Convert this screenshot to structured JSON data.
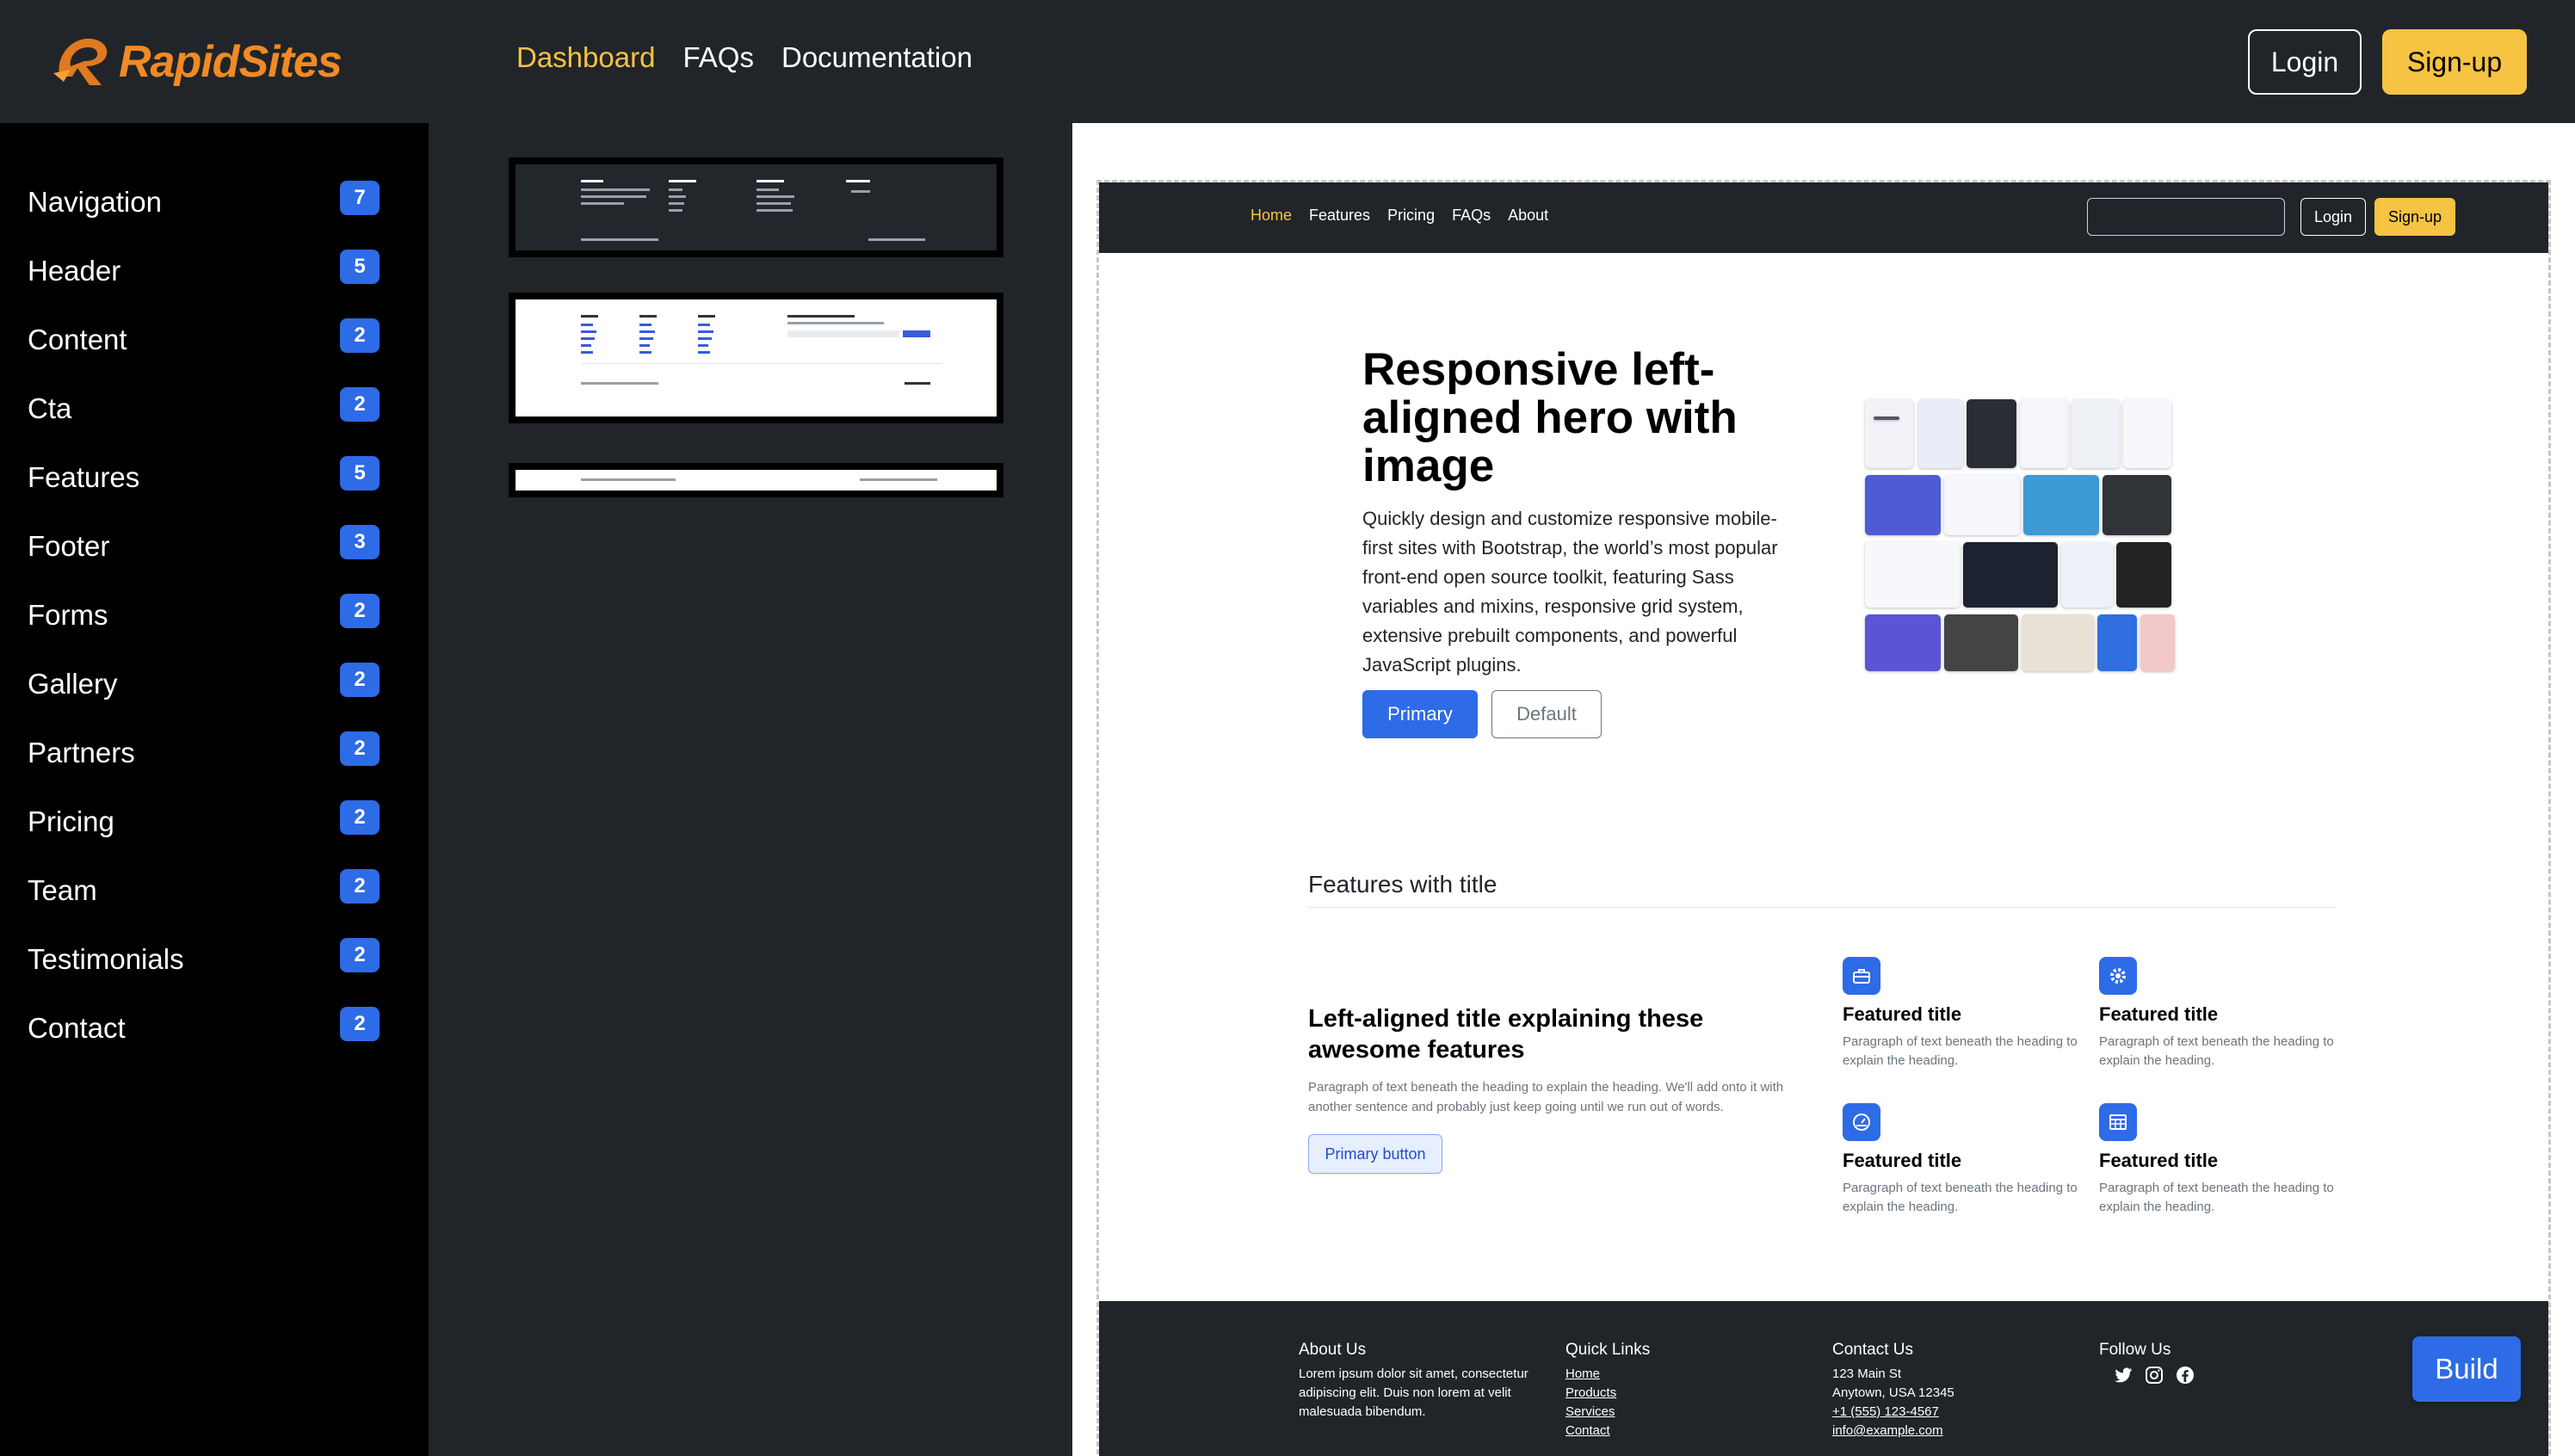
{
  "app": {
    "brand_part1": "Rapid",
    "brand_part2": "Sites",
    "accent_color": "#f6c343",
    "primary_color": "#2e6be6"
  },
  "top_nav": {
    "links": [
      {
        "label": "Dashboard",
        "active": true
      },
      {
        "label": "FAQs",
        "active": false
      },
      {
        "label": "Documentation",
        "active": false
      }
    ],
    "login_label": "Login",
    "signup_label": "Sign-up"
  },
  "sidebar": {
    "items": [
      {
        "label": "Navigation",
        "count": "7"
      },
      {
        "label": "Header",
        "count": "5"
      },
      {
        "label": "Content",
        "count": "2"
      },
      {
        "label": "Cta",
        "count": "2"
      },
      {
        "label": "Features",
        "count": "5"
      },
      {
        "label": "Footer",
        "count": "3"
      },
      {
        "label": "Forms",
        "count": "2"
      },
      {
        "label": "Gallery",
        "count": "2"
      },
      {
        "label": "Partners",
        "count": "2"
      },
      {
        "label": "Pricing",
        "count": "2"
      },
      {
        "label": "Team",
        "count": "2"
      },
      {
        "label": "Testimonials",
        "count": "2"
      },
      {
        "label": "Contact",
        "count": "2"
      }
    ]
  },
  "preview": {
    "nav": {
      "links": [
        "Home",
        "Features",
        "Pricing",
        "FAQs",
        "About"
      ],
      "login_label": "Login",
      "signup_label": "Sign-up"
    },
    "hero": {
      "title": "Responsive left-aligned hero with image",
      "text": "Quickly design and customize responsive mobile-first sites with Bootstrap, the world’s most popular front-end open source toolkit, featuring Sass variables and mixins, responsive grid system, extensive prebuilt components, and powerful JavaScript plugins.",
      "primary_label": "Primary",
      "default_label": "Default"
    },
    "features": {
      "heading": "Features with title",
      "left_title": "Left-aligned title explaining these awesome features",
      "left_text": "Paragraph of text beneath the heading to explain the heading. We'll add onto it with another sentence and probably just keep going until we run out of words.",
      "button_label": "Primary button",
      "cards": [
        {
          "icon": "toolbox-icon",
          "title": "Featured title",
          "text": "Paragraph of text beneath the heading to explain the heading."
        },
        {
          "icon": "gear-icon",
          "title": "Featured title",
          "text": "Paragraph of text beneath the heading to explain the heading."
        },
        {
          "icon": "speedometer-icon",
          "title": "Featured title",
          "text": "Paragraph of text beneath the heading to explain the heading."
        },
        {
          "icon": "table-icon",
          "title": "Featured title",
          "text": "Paragraph of text beneath the heading to explain the heading."
        }
      ]
    },
    "footer": {
      "about_heading": "About Us",
      "about_text": "Lorem ipsum dolor sit amet, consectetur adipiscing elit. Duis non lorem at velit malesuada bibendum.",
      "links_heading": "Quick Links",
      "links": [
        "Home",
        "Products",
        "Services",
        "Contact"
      ],
      "contact_heading": "Contact Us",
      "address1": "123 Main St",
      "address2": "Anytown, USA 12345",
      "phone": "+1 (555) 123-4567",
      "email": "info@example.com",
      "follow_heading": "Follow Us",
      "social_icons": [
        "twitter-icon",
        "instagram-icon",
        "facebook-icon"
      ]
    }
  },
  "build_label": "Build"
}
